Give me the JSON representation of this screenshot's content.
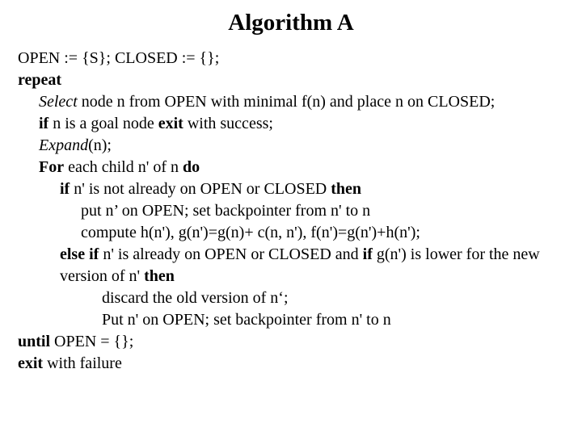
{
  "title": "Algorithm A",
  "l1_a": "OPEN := {S}; CLOSED := {};",
  "l2_a": "repeat",
  "l3_a": "Select",
  "l3_b": " node n from OPEN with minimal f(n) and place n on CLOSED;",
  "l4_a": "if",
  "l4_b": " n is a goal node ",
  "l4_c": "exit",
  "l4_d": " with success;",
  "l5_a": "Expand",
  "l5_b": "(n);",
  "l6_a": "For",
  "l6_b": " each child n' of n ",
  "l6_c": "do",
  "l7_a": "if",
  "l7_b": " n' is not already on OPEN or CLOSED ",
  "l7_c": "then",
  "l8_a": "put n’ on OPEN; set backpointer from n' to n",
  "l9_a": "compute h(n'),  g(n')=g(n)+ c(n, n'),  f(n')=g(n')+h(n');",
  "l10_a": "else if",
  "l10_b": " n' is already on OPEN or CLOSED and ",
  "l10_c": "if",
  "l10_d": " g(n') is lower for the new version of n' ",
  "l10_e": "then",
  "l11_a": "discard the old version of n‘;",
  "l12_a": "Put n' on OPEN; set backpointer from n' to n",
  "l13_a": "until",
  "l13_b": " OPEN = {};",
  "l14_a": "exit",
  "l14_b": " with failure"
}
